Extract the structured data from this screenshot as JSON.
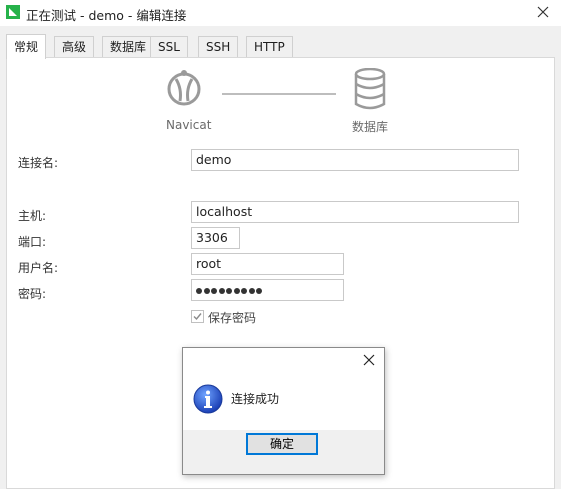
{
  "window": {
    "title": "正在测试 - demo - 编辑连接"
  },
  "tabs": [
    {
      "label": "常规",
      "active": true
    },
    {
      "label": "高级"
    },
    {
      "label": "数据库"
    },
    {
      "label": "SSL"
    },
    {
      "label": "SSH"
    },
    {
      "label": "HTTP"
    }
  ],
  "flow": {
    "left_label": "Navicat",
    "right_label": "数据库"
  },
  "form": {
    "connection_name_label": "连接名:",
    "connection_name_value": "demo",
    "host_label": "主机:",
    "host_value": "localhost",
    "port_label": "端口:",
    "port_value": "3306",
    "username_label": "用户名:",
    "username_value": "root",
    "password_label": "密码:",
    "password_length": 9,
    "save_password_label": "保存密码",
    "save_password_checked": true
  },
  "dialog": {
    "message": "连接成功",
    "ok_label": "确定"
  },
  "colors": {
    "accent": "#0078d7",
    "app_icon": "#26b24a"
  },
  "icons": [
    "navicat-app-icon",
    "close-icon",
    "navicat-logo-icon",
    "database-icon",
    "info-icon",
    "checkmark-icon"
  ]
}
